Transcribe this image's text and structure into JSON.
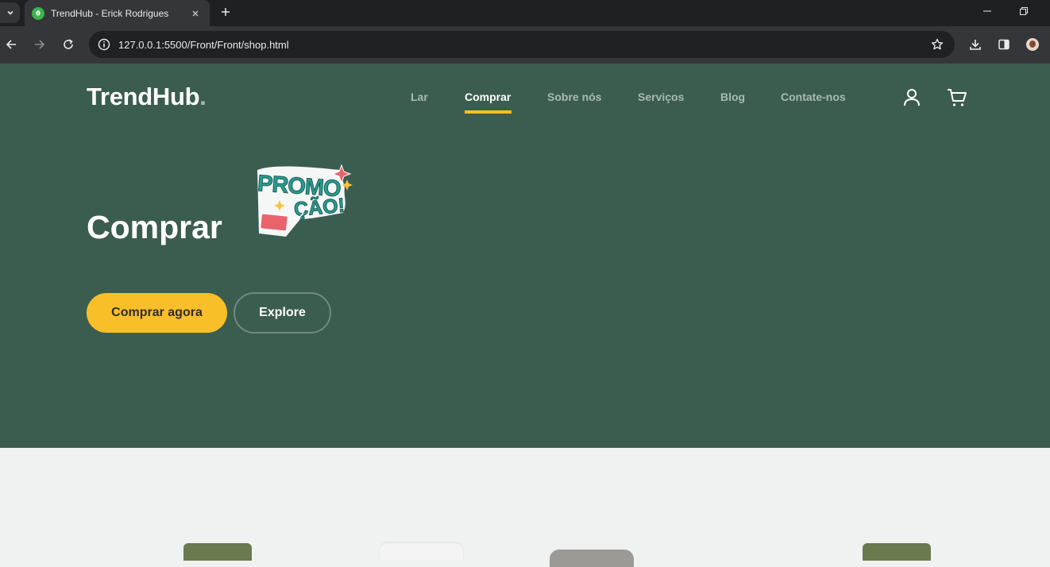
{
  "browser": {
    "tab_title": "TrendHub - Erick Rodrigues",
    "url_host": "127.0.0.1",
    "url_rest": ":5500/Front/Front/shop.html"
  },
  "site": {
    "logo": "TrendHub",
    "logo_dot": ".",
    "nav": [
      {
        "label": "Lar",
        "active": false
      },
      {
        "label": "Comprar",
        "active": true
      },
      {
        "label": "Sobre nós",
        "active": false
      },
      {
        "label": "Serviços",
        "active": false
      },
      {
        "label": "Blog",
        "active": false
      },
      {
        "label": "Contate-nos",
        "active": false
      }
    ],
    "accent_color": "#f9bf29",
    "hero_bg_color": "#3b5d50"
  },
  "hero": {
    "title": "Comprar",
    "sticker_line1": "PROMO",
    "sticker_line2": "ÇÃO!",
    "primary_button": "Comprar agora",
    "secondary_button": "Explore"
  }
}
